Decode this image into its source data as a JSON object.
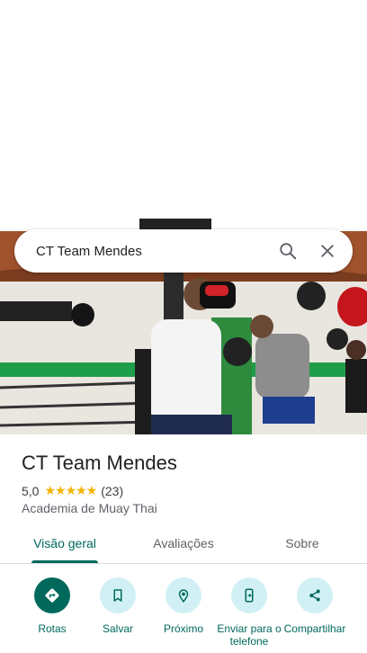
{
  "search": {
    "query": "CT Team Mendes"
  },
  "place": {
    "name": "CT Team Mendes",
    "rating": "5,0",
    "stars": "★★★★★",
    "reviews": "(23)",
    "category": "Academia de Muay Thai"
  },
  "tabs": [
    {
      "label": "Visão geral",
      "active": true
    },
    {
      "label": "Avaliações",
      "active": false
    },
    {
      "label": "Sobre",
      "active": false
    }
  ],
  "actions": [
    {
      "label": "Rotas",
      "icon": "directions-icon"
    },
    {
      "label": "Salvar",
      "icon": "bookmark-icon"
    },
    {
      "label": "Próximo",
      "icon": "nearby-icon"
    },
    {
      "label": "Enviar para o telefone",
      "icon": "send-to-phone-icon"
    },
    {
      "label": "Compartilhar",
      "icon": "share-icon"
    }
  ],
  "colors": {
    "accent": "#00695c",
    "action_bg": "#d1f0f5",
    "star": "#f4b400"
  }
}
